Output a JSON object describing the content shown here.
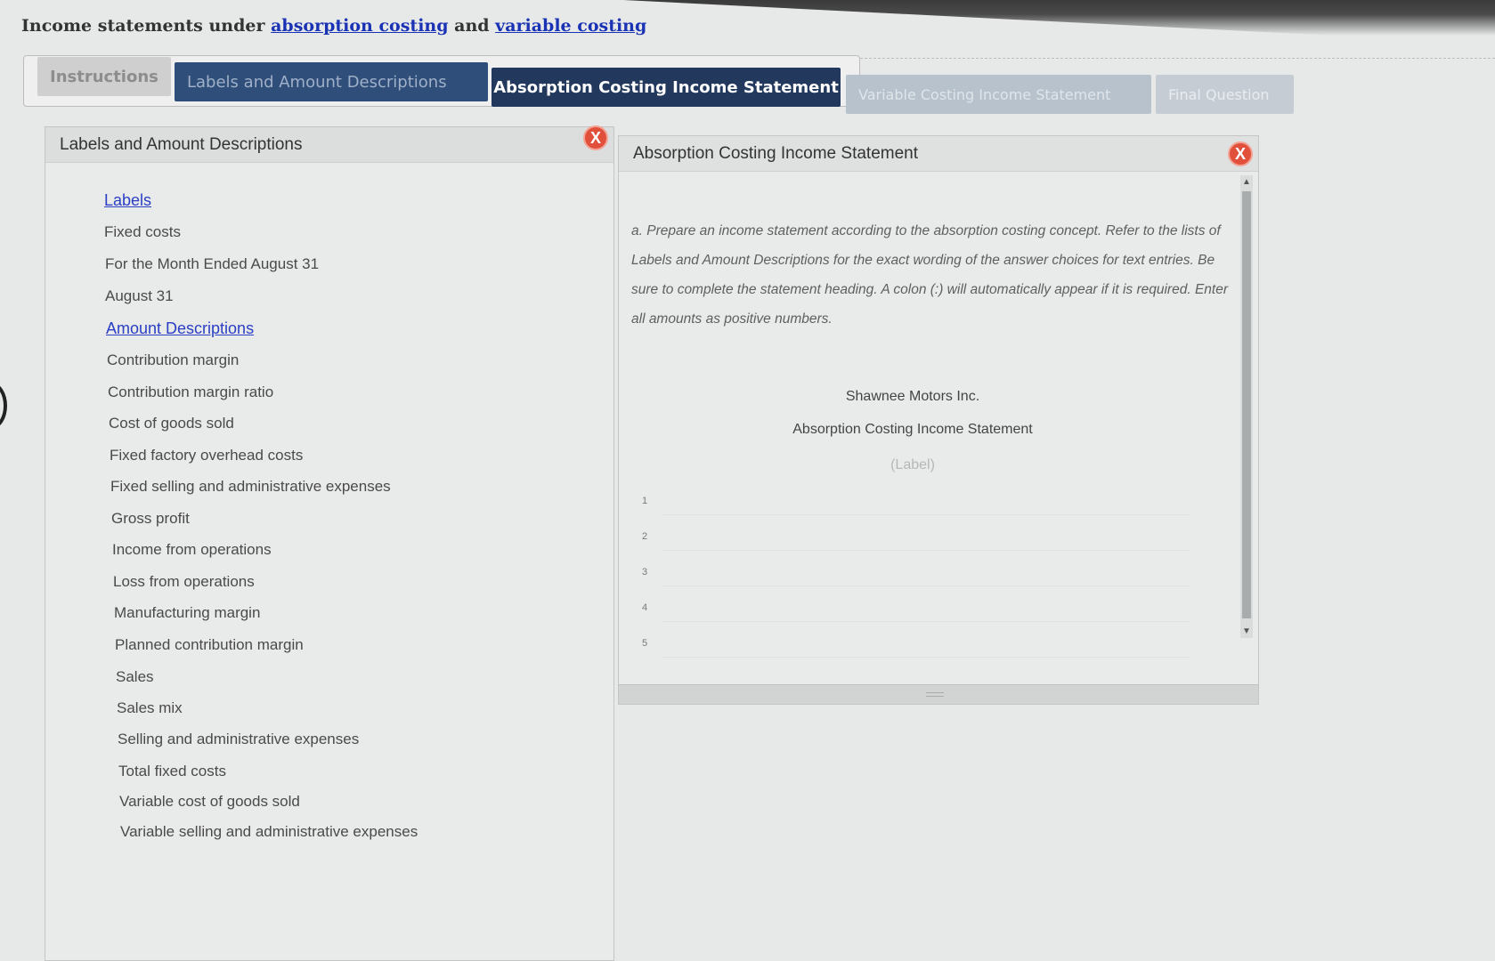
{
  "page": {
    "title_prefix": "Income statements under ",
    "link_absorption": "absorption costing",
    "title_and": " and ",
    "link_variable": "variable costing"
  },
  "tabs": {
    "instructions": "Instructions",
    "labels": "Labels and Amount Descriptions",
    "absorption": "Absorption Costing Income Statement",
    "variable": "Variable Costing Income Statement",
    "final": "Final Question"
  },
  "left_panel": {
    "title": "Labels and Amount Descriptions",
    "close": "X",
    "labels_heading": "Labels",
    "labels": [
      "Fixed costs",
      "For the Month Ended August 31",
      "August 31"
    ],
    "amounts_heading": "Amount Descriptions",
    "amounts": [
      "Contribution margin",
      "Contribution margin ratio",
      "Cost of goods sold",
      "Fixed factory overhead costs",
      "Fixed selling and administrative expenses",
      "Gross profit",
      "Income from operations",
      "Loss from operations",
      "Manufacturing margin",
      "Planned contribution margin",
      "Sales",
      "Sales mix",
      "Selling and administrative expenses",
      "Total fixed costs",
      "Variable cost of goods sold",
      "Variable selling and administrative expenses"
    ]
  },
  "right_panel": {
    "title": "Absorption Costing Income Statement",
    "close": "X",
    "instructions": "a. Prepare an income statement according to the absorption costing concept. Refer to the lists of Labels and Amount Descriptions for the exact wording of the answer choices for text entries. Be sure to complete the statement heading. A colon (:) will automatically appear if it is required. Enter all amounts as positive numbers.",
    "company": "Shawnee Motors Inc.",
    "statement_name": "Absorption Costing Income Statement",
    "label_placeholder": "(Label)",
    "rows": [
      "1",
      "2",
      "3",
      "4",
      "5"
    ]
  }
}
